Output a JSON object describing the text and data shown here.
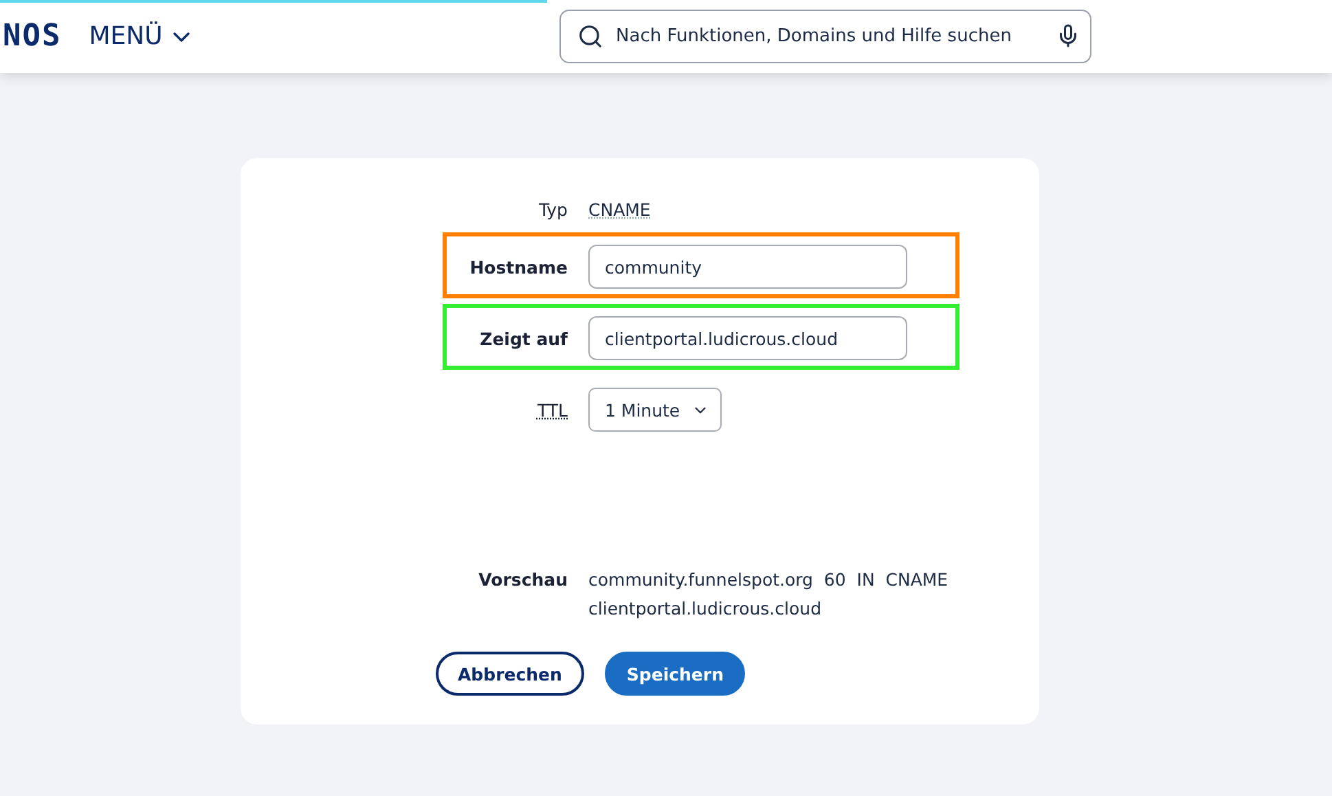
{
  "header": {
    "logo": "NOS",
    "menu": "MENÜ",
    "search": {
      "placeholder": "Nach Funktionen, Domains und Hilfe suchen"
    }
  },
  "form": {
    "rows": [
      {
        "kind": "text",
        "label": "Typ",
        "value": "CNAME"
      },
      {
        "kind": "input",
        "label": "Hostname",
        "value": "community",
        "color": "#ff8000"
      },
      {
        "kind": "input",
        "label": "Zeigt auf",
        "value": "clientportal.ludicrous.cloud",
        "color": "#33ee33"
      },
      {
        "kind": "select",
        "label": "TTL",
        "value": "1 Minute",
        "label_underlined": true
      }
    ],
    "preview": {
      "label": "Vorschau",
      "lines": [
        "community.funnelspot.org  60  IN  CNAME",
        "clientportal.ludicrous.cloud"
      ]
    },
    "buttons": [
      {
        "label": "Abbrechen",
        "kind": "secondary"
      },
      {
        "label": "Speichern",
        "kind": "primary"
      }
    ]
  }
}
